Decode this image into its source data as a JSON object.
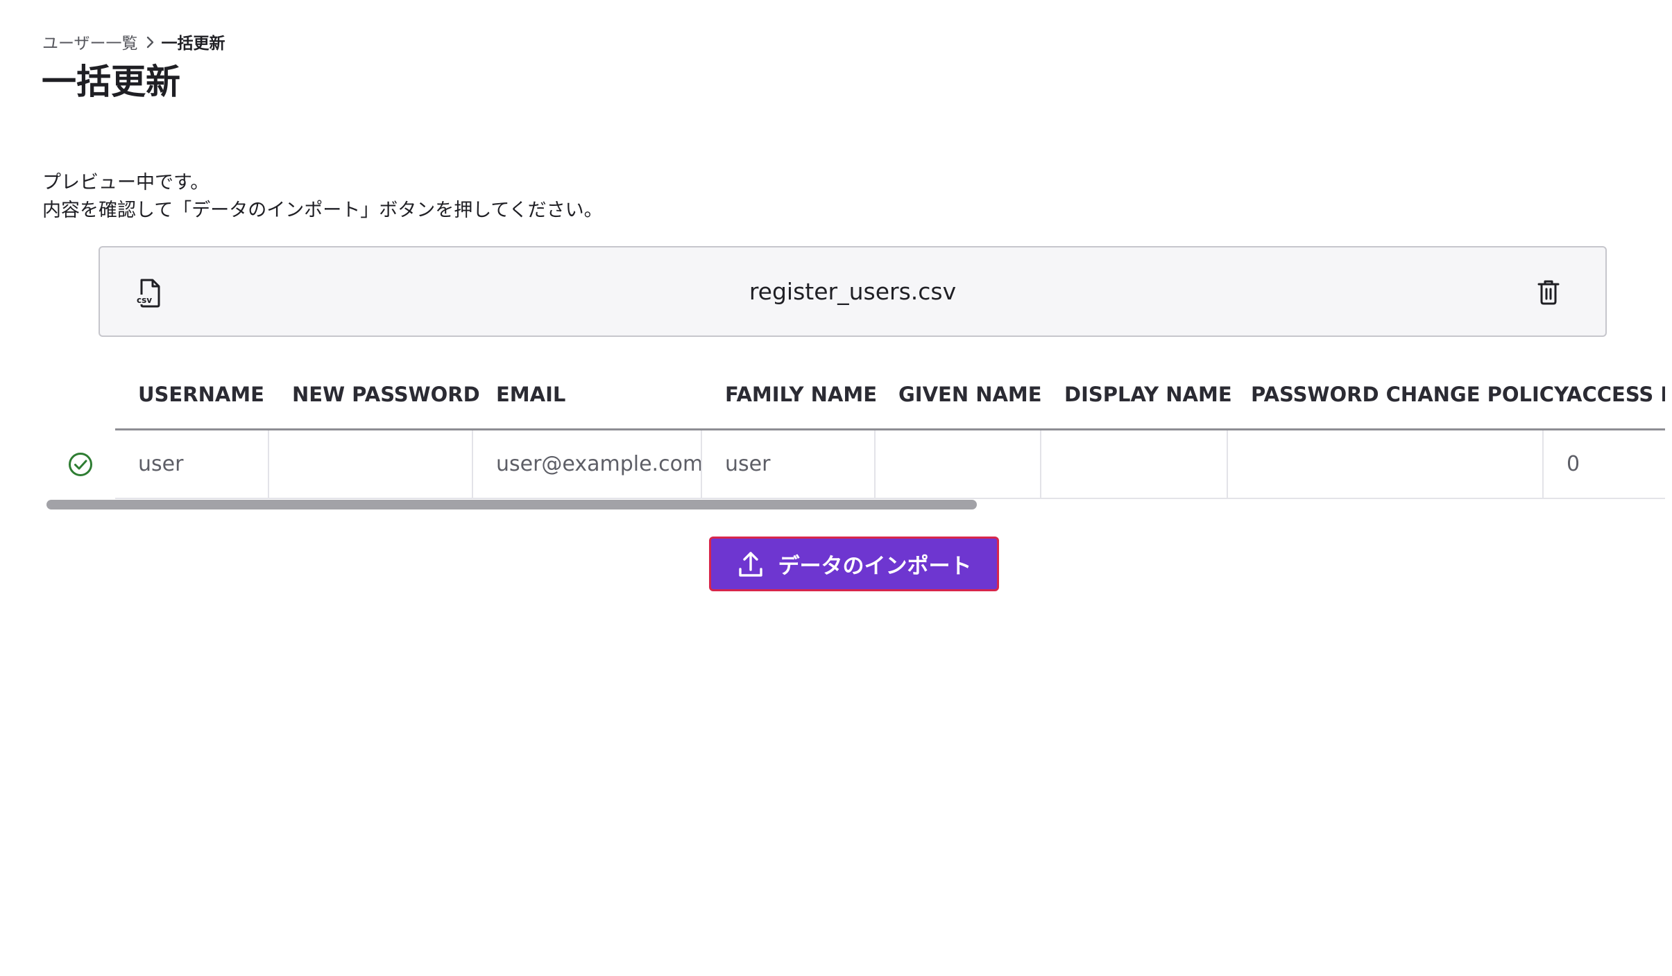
{
  "breadcrumb": {
    "parent": "ユーザー一覧",
    "current": "一括更新"
  },
  "page": {
    "title": "一括更新"
  },
  "notice": {
    "line1": "プレビュー中です。",
    "line2": "内容を確認して「データのインポート」ボタンを押してください。"
  },
  "file": {
    "name": "register_users.csv",
    "icon": "csv-file-icon",
    "icon_text": "csv",
    "delete_icon": "trash-icon"
  },
  "table": {
    "columns": [
      "USERNAME",
      "NEW PASSWORD",
      "EMAIL",
      "FAMILY NAME",
      "GIVEN NAME",
      "DISPLAY NAME",
      "PASSWORD CHANGE POLICY",
      "ACCESS POLICY"
    ],
    "rows": [
      {
        "status": "valid",
        "status_icon": "check-circle-icon",
        "cells": [
          "user",
          "",
          "user@example.com",
          "user",
          "",
          "",
          "",
          "0"
        ]
      }
    ]
  },
  "actions": {
    "import_label": "データのインポート",
    "import_icon": "upload-icon"
  },
  "colors": {
    "primary": "#6e36d0",
    "focus_ring": "#d7264c",
    "success": "#2e7d32",
    "text": "#1f1f24"
  }
}
